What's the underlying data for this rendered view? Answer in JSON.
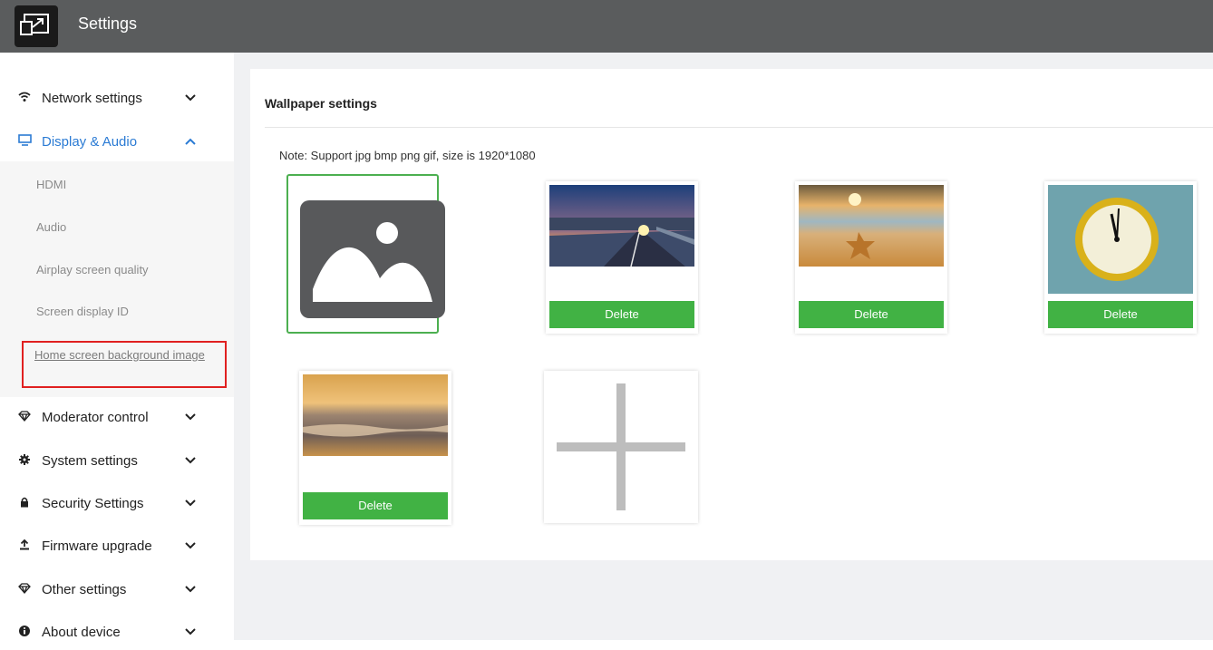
{
  "header": {
    "title": "Settings",
    "logo_icon": "screen-cast-icon"
  },
  "sidebar": {
    "items": [
      {
        "label": "Network settings",
        "icon": "wifi-icon",
        "chevron": "chevron-down-icon"
      },
      {
        "label": "Display & Audio",
        "icon": "monitor-icon",
        "chevron": "chevron-up-icon"
      },
      {
        "label": "Moderator control",
        "icon": "diamond-icon",
        "chevron": "chevron-down-icon"
      },
      {
        "label": "System settings",
        "icon": "gear-icon",
        "chevron": "chevron-down-icon"
      },
      {
        "label": "Security Settings",
        "icon": "lock-icon",
        "chevron": "chevron-down-icon"
      },
      {
        "label": "Firmware upgrade",
        "icon": "upload-icon",
        "chevron": "chevron-down-icon"
      },
      {
        "label": "Other settings",
        "icon": "diamond-icon",
        "chevron": "chevron-down-icon"
      },
      {
        "label": "About device",
        "icon": "info-icon",
        "chevron": "chevron-down-icon"
      }
    ],
    "display_submenu": [
      {
        "label": "HDMI"
      },
      {
        "label": "Audio"
      },
      {
        "label": "Airplay screen quality"
      },
      {
        "label": "Screen display ID"
      },
      {
        "label": "Home screen background image"
      }
    ]
  },
  "main": {
    "section_title": "Wallpaper settings",
    "note": "Note: Support jpg bmp png gif, size is 1920*1080",
    "delete_label": "Delete",
    "wallpapers": [
      {
        "name": "default-placeholder",
        "selected": true
      },
      {
        "name": "road-sunset"
      },
      {
        "name": "starfish-beach"
      },
      {
        "name": "wall-clock"
      },
      {
        "name": "sea-sunset"
      }
    ]
  },
  "colors": {
    "accent": "#2b7bd4",
    "delete_button": "#41b244",
    "selected_border": "#4caf50",
    "highlight_border": "#e02020"
  }
}
